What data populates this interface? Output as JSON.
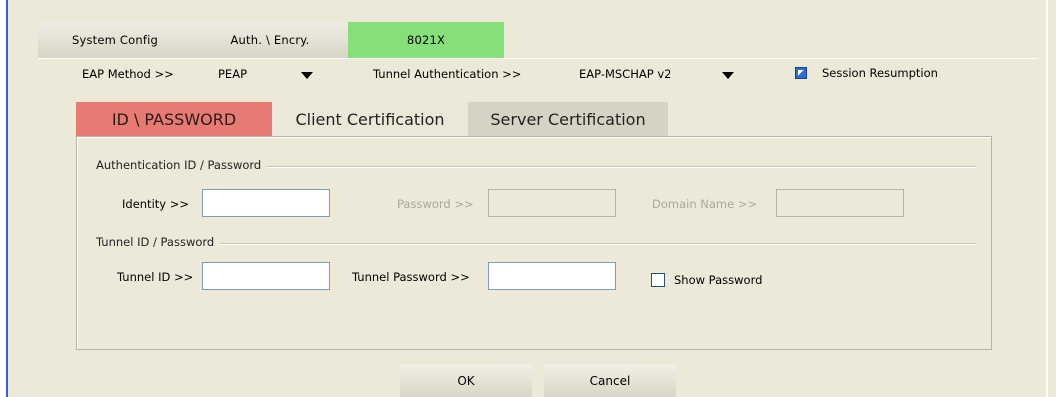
{
  "top_tabs": {
    "system_config": "System Config",
    "auth_encry": "Auth. \\ Encry.",
    "x8021": "8021X"
  },
  "eap": {
    "method_label": "EAP Method >>",
    "method_value": "PEAP",
    "tunnel_auth_label": "Tunnel Authentication >>",
    "tunnel_auth_value": "EAP-MSCHAP v2",
    "session_resumption_label": "Session Resumption",
    "session_resumption_checked": true
  },
  "sub_tabs": {
    "id_password": "ID \\ PASSWORD",
    "client_cert": "Client Certification",
    "server_cert": "Server Certification"
  },
  "auth_group": {
    "title": "Authentication ID / Password",
    "identity_label": "Identity >>",
    "identity_value": "",
    "password_label": "Password >>",
    "password_value": "",
    "domain_label": "Domain Name >>",
    "domain_value": ""
  },
  "tunnel_group": {
    "title": "Tunnel ID / Password",
    "tunnel_id_label": "Tunnel ID >>",
    "tunnel_id_value": "",
    "tunnel_password_label": "Tunnel Password >>",
    "tunnel_password_value": "",
    "show_password_label": "Show Password",
    "show_password_checked": false
  },
  "buttons": {
    "ok": "OK",
    "cancel": "Cancel"
  },
  "colors": {
    "active_top_tab": "#86e07a",
    "active_sub_tab": "#e77a72",
    "window_bg": "#ece9d8",
    "accent_blue": "#3163d6"
  }
}
